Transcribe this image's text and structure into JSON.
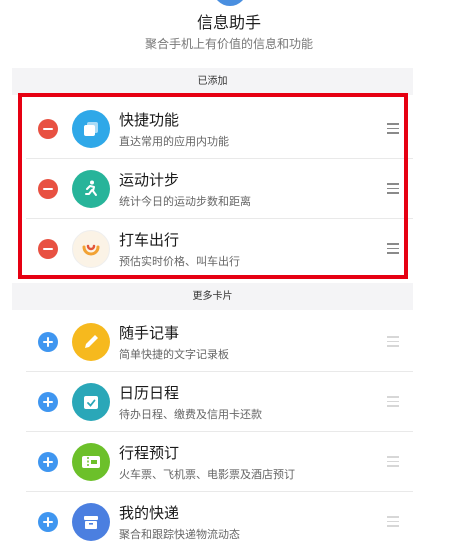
{
  "header": {
    "title": "信息助手",
    "subtitle": "聚合手机上有价值的信息和功能"
  },
  "added_section": {
    "label": "已添加",
    "items": [
      {
        "title": "快捷功能",
        "desc": "直达常用的应用内功能",
        "icon": "shortcut-cards-icon",
        "icon_color": "#2fa8e8"
      },
      {
        "title": "运动计步",
        "desc": "统计今日的运动步数和距离",
        "icon": "running-person-icon",
        "icon_color": "#27b49a"
      },
      {
        "title": "打车出行",
        "desc": "预估实时价格、叫车出行",
        "icon": "didi-logo-icon",
        "icon_color": "#f2a233"
      }
    ]
  },
  "more_section": {
    "label": "更多卡片",
    "items": [
      {
        "title": "随手记事",
        "desc": "简单快捷的文字记录板",
        "icon": "pencil-icon",
        "icon_color": "#f6b91e"
      },
      {
        "title": "日历日程",
        "desc": "待办日程、缴费及信用卡还款",
        "icon": "calendar-check-icon",
        "icon_color": "#2aa7b8"
      },
      {
        "title": "行程预订",
        "desc": "火车票、飞机票、电影票及酒店预订",
        "icon": "ticket-icon",
        "icon_color": "#6cc02a"
      },
      {
        "title": "我的快递",
        "desc": "聚合和跟踪快递物流动态",
        "icon": "package-box-icon",
        "icon_color": "#4b7fe0"
      }
    ]
  },
  "colors": {
    "remove_button": "#e85142",
    "add_button": "#3f96f0",
    "highlight_border": "#e60012"
  }
}
